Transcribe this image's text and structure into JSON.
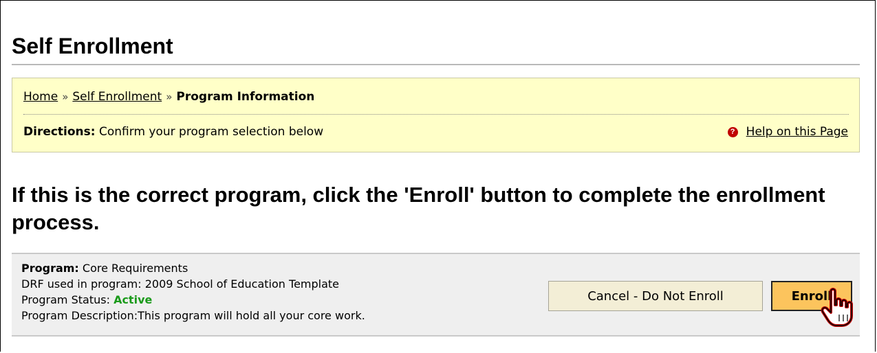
{
  "page": {
    "title": "Self Enrollment"
  },
  "breadcrumb": {
    "home": "Home",
    "separator": "»",
    "self_enrollment": "Self Enrollment",
    "current": "Program Information"
  },
  "directions": {
    "label": "Directions:",
    "text": "Confirm your program selection below"
  },
  "help": {
    "icon": "question-mark",
    "label": "Help on this Page"
  },
  "headline": "If this is the correct program, click the 'Enroll' button to complete the enrollment process.",
  "program": {
    "program_label": "Program:",
    "program_value": "Core Requirements",
    "drf_label": "DRF used in program:",
    "drf_value": "2009 School of Education Template",
    "status_label": "Program Status:",
    "status_value": "Active",
    "status_color": "#1a9a1a",
    "description_label": "Program Description:",
    "description_value": "This program will hold all your core work."
  },
  "buttons": {
    "cancel": "Cancel - Do Not Enroll",
    "enroll": "Enroll"
  },
  "colors": {
    "info_background": "#ffffc8",
    "enroll_button": "#fcc45d",
    "cancel_button": "#f3eed6",
    "panel_background": "#efefef"
  }
}
